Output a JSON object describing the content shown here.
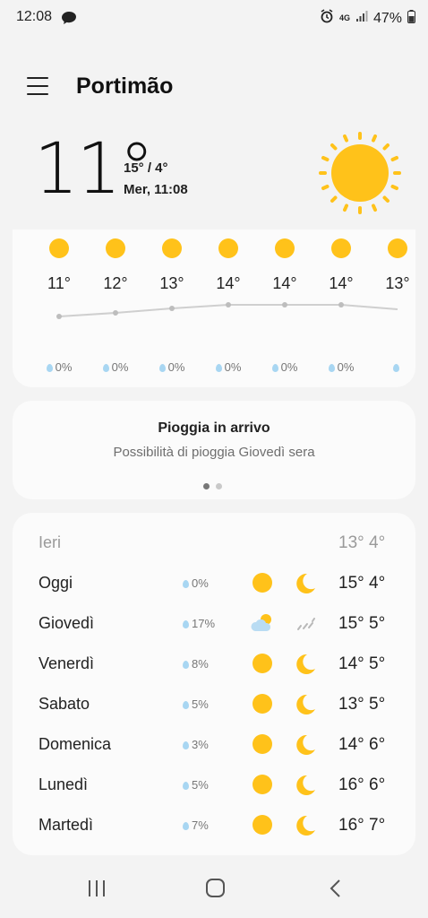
{
  "status_bar": {
    "time": "12:08",
    "network": "4G",
    "battery": "47%"
  },
  "header": {
    "city": "Portimão"
  },
  "current": {
    "temperature": "11°",
    "hi_lo": "15° / 4°",
    "datetime": "Mer, 11:08",
    "icon": "sun-icon"
  },
  "hourly": [
    {
      "temp": "11°",
      "precip": "0%"
    },
    {
      "temp": "12°",
      "precip": "0%"
    },
    {
      "temp": "13°",
      "precip": "0%"
    },
    {
      "temp": "14°",
      "precip": "0%"
    },
    {
      "temp": "14°",
      "precip": "0%"
    },
    {
      "temp": "14°",
      "precip": "0%"
    },
    {
      "temp": "13°",
      "precip": ""
    }
  ],
  "rain_card": {
    "title": "Pioggia in arrivo",
    "subtitle": "Possibilità di pioggia Giovedì sera"
  },
  "daily": [
    {
      "day": "Ieri",
      "precip": "",
      "temps": "13° 4°",
      "day_icon": "",
      "night_icon": ""
    },
    {
      "day": "Oggi",
      "precip": "0%",
      "temps": "15° 4°",
      "day_icon": "sun-icon",
      "night_icon": "moon-icon"
    },
    {
      "day": "Giovedì",
      "precip": "17%",
      "temps": "15° 5°",
      "day_icon": "partly-cloudy-icon",
      "night_icon": "rain-icon"
    },
    {
      "day": "Venerdì",
      "precip": "8%",
      "temps": "14° 5°",
      "day_icon": "sun-icon",
      "night_icon": "moon-icon"
    },
    {
      "day": "Sabato",
      "precip": "5%",
      "temps": "13° 5°",
      "day_icon": "sun-icon",
      "night_icon": "moon-icon"
    },
    {
      "day": "Domenica",
      "precip": "3%",
      "temps": "14° 6°",
      "day_icon": "sun-icon",
      "night_icon": "moon-icon"
    },
    {
      "day": "Lunedì",
      "precip": "5%",
      "temps": "16° 6°",
      "day_icon": "sun-icon",
      "night_icon": "moon-icon"
    },
    {
      "day": "Martedì",
      "precip": "7%",
      "temps": "16° 7°",
      "day_icon": "sun-icon",
      "night_icon": "moon-icon"
    }
  ],
  "colors": {
    "sun": "#ffc21a",
    "drop": "#a8d6f2",
    "card": "#fbfbfb",
    "background": "#f3f3f3"
  }
}
